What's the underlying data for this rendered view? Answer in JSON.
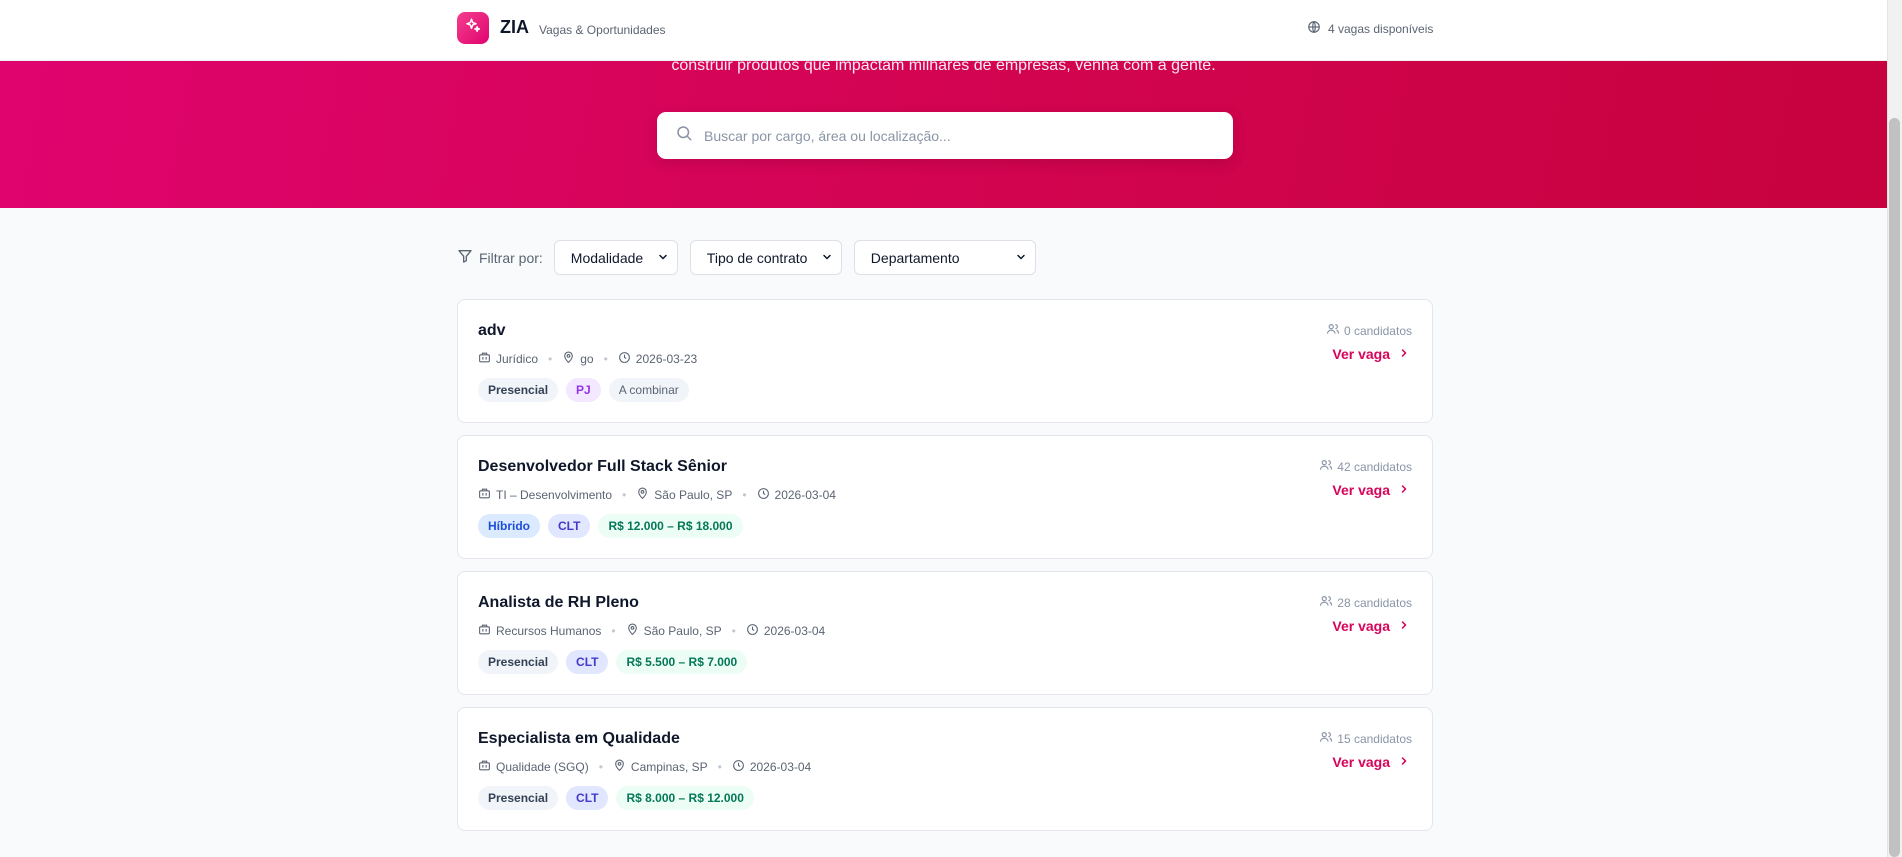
{
  "header": {
    "brand": "ZIA",
    "subtitle": "Vagas & Oportunidades",
    "jobs_available": "4 vagas disponíveis"
  },
  "hero": {
    "text": "construir produtos que impactam milhares de empresas, venha com a gente.",
    "search_placeholder": "Buscar por cargo, área ou localização..."
  },
  "filters": {
    "label": "Filtrar por:",
    "modality": "Modalidade",
    "contract": "Tipo de contrato",
    "department": "Departamento"
  },
  "jobs": [
    {
      "title": "adv",
      "department": "Jurídico",
      "location": "go",
      "date": "2026-03-23",
      "candidates": "0 candidatos",
      "cta": "Ver vaga",
      "tags": [
        "Presencial",
        "PJ",
        "A combinar"
      ]
    },
    {
      "title": "Desenvolvedor Full Stack Sênior",
      "department": "TI – Desenvolvimento",
      "location": "São Paulo, SP",
      "date": "2026-03-04",
      "candidates": "42 candidatos",
      "cta": "Ver vaga",
      "tags": [
        "Híbrido",
        "CLT",
        "R$ 12.000 – R$ 18.000"
      ]
    },
    {
      "title": "Analista de RH Pleno",
      "department": "Recursos Humanos",
      "location": "São Paulo, SP",
      "date": "2026-03-04",
      "candidates": "28 candidatos",
      "cta": "Ver vaga",
      "tags": [
        "Presencial",
        "CLT",
        "R$ 5.500 – R$ 7.000"
      ]
    },
    {
      "title": "Especialista em Qualidade",
      "department": "Qualidade (SGQ)",
      "location": "Campinas, SP",
      "date": "2026-03-04",
      "candidates": "15 candidatos",
      "cta": "Ver vaga",
      "tags": [
        "Presencial",
        "CLT",
        "R$ 8.000 – R$ 12.000"
      ]
    }
  ],
  "colors": {
    "brand": "#e0046f",
    "accent_link": "#d6045b"
  }
}
